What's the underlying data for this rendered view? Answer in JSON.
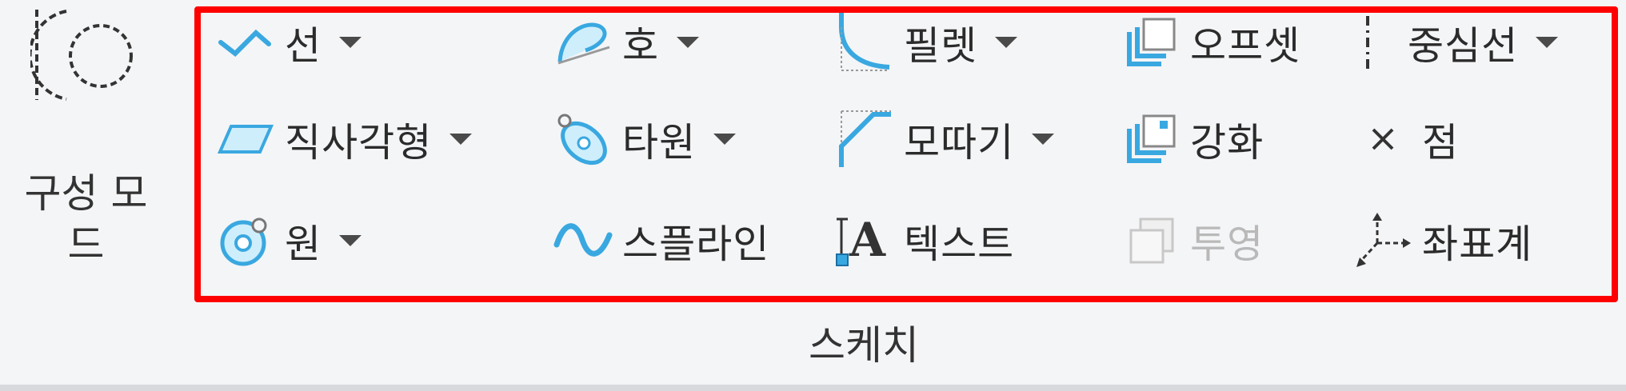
{
  "construction_mode": {
    "label_line1": "구성 모",
    "label_line2": "드",
    "icon": "construction-mode-icon"
  },
  "group": {
    "label": "스케치"
  },
  "tools": {
    "line": {
      "label": "선",
      "icon": "line-icon"
    },
    "rectangle": {
      "label": "직사각형",
      "icon": "rectangle-icon"
    },
    "circle": {
      "label": "원",
      "icon": "circle-icon"
    },
    "arc": {
      "label": "호",
      "icon": "arc-icon"
    },
    "ellipse": {
      "label": "타원",
      "icon": "ellipse-icon"
    },
    "spline": {
      "label": "스플라인",
      "icon": "spline-icon"
    },
    "fillet": {
      "label": "필렛",
      "icon": "fillet-icon"
    },
    "chamfer": {
      "label": "모따기",
      "icon": "chamfer-icon"
    },
    "text": {
      "label": "텍스트",
      "icon": "text-icon"
    },
    "offset": {
      "label": "오프셋",
      "icon": "offset-icon"
    },
    "thicken": {
      "label": "강화",
      "icon": "thicken-icon"
    },
    "project": {
      "label": "투영",
      "icon": "project-icon",
      "disabled": true
    },
    "centerline": {
      "label": "중심선",
      "icon": "centerline-icon"
    },
    "point": {
      "label": "점",
      "icon": "point-icon"
    },
    "coordinate_system": {
      "label": "좌표계",
      "icon": "coordinate-system-icon"
    }
  },
  "colors": {
    "accent": "#3aa8e0",
    "highlight_frame": "#ff0000",
    "disabled_text": "#b9b9b9"
  }
}
